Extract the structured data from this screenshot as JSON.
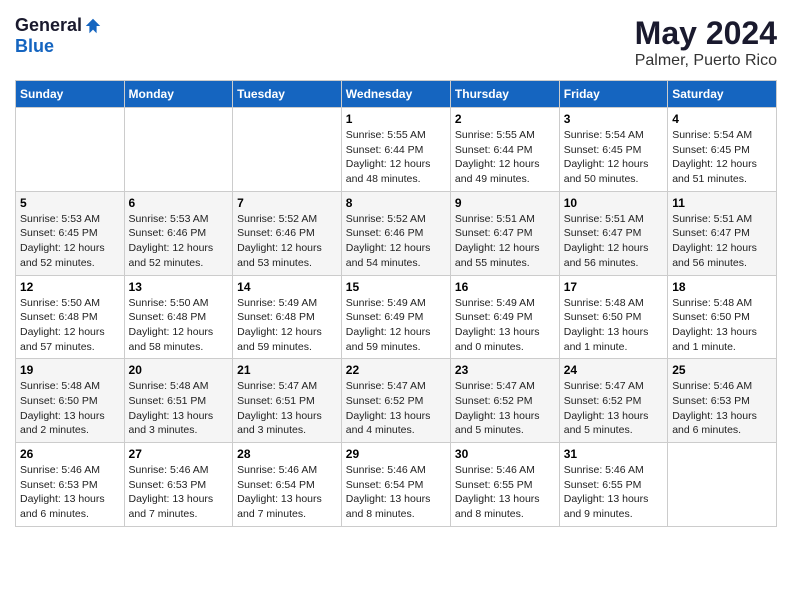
{
  "logo": {
    "general": "General",
    "blue": "Blue"
  },
  "title": "May 2024",
  "location": "Palmer, Puerto Rico",
  "days_of_week": [
    "Sunday",
    "Monday",
    "Tuesday",
    "Wednesday",
    "Thursday",
    "Friday",
    "Saturday"
  ],
  "weeks": [
    [
      {
        "day": "",
        "info": ""
      },
      {
        "day": "",
        "info": ""
      },
      {
        "day": "",
        "info": ""
      },
      {
        "day": "1",
        "info": "Sunrise: 5:55 AM\nSunset: 6:44 PM\nDaylight: 12 hours\nand 48 minutes."
      },
      {
        "day": "2",
        "info": "Sunrise: 5:55 AM\nSunset: 6:44 PM\nDaylight: 12 hours\nand 49 minutes."
      },
      {
        "day": "3",
        "info": "Sunrise: 5:54 AM\nSunset: 6:45 PM\nDaylight: 12 hours\nand 50 minutes."
      },
      {
        "day": "4",
        "info": "Sunrise: 5:54 AM\nSunset: 6:45 PM\nDaylight: 12 hours\nand 51 minutes."
      }
    ],
    [
      {
        "day": "5",
        "info": "Sunrise: 5:53 AM\nSunset: 6:45 PM\nDaylight: 12 hours\nand 52 minutes."
      },
      {
        "day": "6",
        "info": "Sunrise: 5:53 AM\nSunset: 6:46 PM\nDaylight: 12 hours\nand 52 minutes."
      },
      {
        "day": "7",
        "info": "Sunrise: 5:52 AM\nSunset: 6:46 PM\nDaylight: 12 hours\nand 53 minutes."
      },
      {
        "day": "8",
        "info": "Sunrise: 5:52 AM\nSunset: 6:46 PM\nDaylight: 12 hours\nand 54 minutes."
      },
      {
        "day": "9",
        "info": "Sunrise: 5:51 AM\nSunset: 6:47 PM\nDaylight: 12 hours\nand 55 minutes."
      },
      {
        "day": "10",
        "info": "Sunrise: 5:51 AM\nSunset: 6:47 PM\nDaylight: 12 hours\nand 56 minutes."
      },
      {
        "day": "11",
        "info": "Sunrise: 5:51 AM\nSunset: 6:47 PM\nDaylight: 12 hours\nand 56 minutes."
      }
    ],
    [
      {
        "day": "12",
        "info": "Sunrise: 5:50 AM\nSunset: 6:48 PM\nDaylight: 12 hours\nand 57 minutes."
      },
      {
        "day": "13",
        "info": "Sunrise: 5:50 AM\nSunset: 6:48 PM\nDaylight: 12 hours\nand 58 minutes."
      },
      {
        "day": "14",
        "info": "Sunrise: 5:49 AM\nSunset: 6:48 PM\nDaylight: 12 hours\nand 59 minutes."
      },
      {
        "day": "15",
        "info": "Sunrise: 5:49 AM\nSunset: 6:49 PM\nDaylight: 12 hours\nand 59 minutes."
      },
      {
        "day": "16",
        "info": "Sunrise: 5:49 AM\nSunset: 6:49 PM\nDaylight: 13 hours\nand 0 minutes."
      },
      {
        "day": "17",
        "info": "Sunrise: 5:48 AM\nSunset: 6:50 PM\nDaylight: 13 hours\nand 1 minute."
      },
      {
        "day": "18",
        "info": "Sunrise: 5:48 AM\nSunset: 6:50 PM\nDaylight: 13 hours\nand 1 minute."
      }
    ],
    [
      {
        "day": "19",
        "info": "Sunrise: 5:48 AM\nSunset: 6:50 PM\nDaylight: 13 hours\nand 2 minutes."
      },
      {
        "day": "20",
        "info": "Sunrise: 5:48 AM\nSunset: 6:51 PM\nDaylight: 13 hours\nand 3 minutes."
      },
      {
        "day": "21",
        "info": "Sunrise: 5:47 AM\nSunset: 6:51 PM\nDaylight: 13 hours\nand 3 minutes."
      },
      {
        "day": "22",
        "info": "Sunrise: 5:47 AM\nSunset: 6:52 PM\nDaylight: 13 hours\nand 4 minutes."
      },
      {
        "day": "23",
        "info": "Sunrise: 5:47 AM\nSunset: 6:52 PM\nDaylight: 13 hours\nand 5 minutes."
      },
      {
        "day": "24",
        "info": "Sunrise: 5:47 AM\nSunset: 6:52 PM\nDaylight: 13 hours\nand 5 minutes."
      },
      {
        "day": "25",
        "info": "Sunrise: 5:46 AM\nSunset: 6:53 PM\nDaylight: 13 hours\nand 6 minutes."
      }
    ],
    [
      {
        "day": "26",
        "info": "Sunrise: 5:46 AM\nSunset: 6:53 PM\nDaylight: 13 hours\nand 6 minutes."
      },
      {
        "day": "27",
        "info": "Sunrise: 5:46 AM\nSunset: 6:53 PM\nDaylight: 13 hours\nand 7 minutes."
      },
      {
        "day": "28",
        "info": "Sunrise: 5:46 AM\nSunset: 6:54 PM\nDaylight: 13 hours\nand 7 minutes."
      },
      {
        "day": "29",
        "info": "Sunrise: 5:46 AM\nSunset: 6:54 PM\nDaylight: 13 hours\nand 8 minutes."
      },
      {
        "day": "30",
        "info": "Sunrise: 5:46 AM\nSunset: 6:55 PM\nDaylight: 13 hours\nand 8 minutes."
      },
      {
        "day": "31",
        "info": "Sunrise: 5:46 AM\nSunset: 6:55 PM\nDaylight: 13 hours\nand 9 minutes."
      },
      {
        "day": "",
        "info": ""
      }
    ]
  ]
}
